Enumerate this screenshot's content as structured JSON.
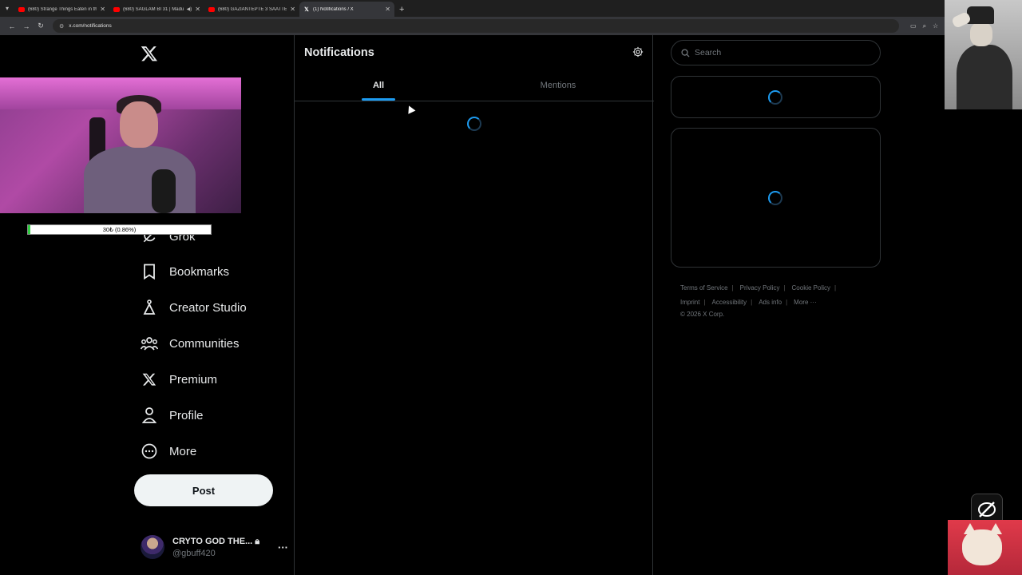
{
  "browser": {
    "tabs": [
      {
        "title": "(680) Strange Things Eaten in th",
        "favicon": "youtube-icon"
      },
      {
        "title": "(680) SAĞLAM Bİ 31 | Madu",
        "favicon": "youtube-icon"
      },
      {
        "title": "(680) GAZİANTEPTE 3 SAATTE",
        "favicon": "youtube-icon"
      },
      {
        "title": "(1) Notifications / X",
        "favicon": "x-icon",
        "active": true
      }
    ],
    "url": "x.com/notifications"
  },
  "sidebar": {
    "items": [
      {
        "label": "Grok",
        "icon": "grok-icon"
      },
      {
        "label": "Bookmarks",
        "icon": "bookmark-icon"
      },
      {
        "label": "Creator Studio",
        "icon": "creator-studio-icon"
      },
      {
        "label": "Communities",
        "icon": "communities-icon"
      },
      {
        "label": "Premium",
        "icon": "x-icon"
      },
      {
        "label": "Profile",
        "icon": "person-icon"
      },
      {
        "label": "More",
        "icon": "more-circle-icon"
      }
    ],
    "post_label": "Post",
    "account": {
      "name": "CRYTO GOD THE...",
      "handle": "@gbuff420"
    }
  },
  "stream_overlay": {
    "progress_text": "30₺ (0.86%)",
    "progress_fraction": 0.0086
  },
  "main": {
    "title": "Notifications",
    "tabs": [
      {
        "label": "All",
        "active": true
      },
      {
        "label": "Mentions",
        "active": false
      }
    ]
  },
  "right": {
    "search_placeholder": "Search",
    "footer_row1": [
      "Terms of Service",
      "Privacy Policy",
      "Cookie Policy"
    ],
    "footer_row2": [
      "Imprint",
      "Accessibility",
      "Ads info",
      "More ···"
    ],
    "copyright": "© 2026 X Corp."
  },
  "colors": {
    "accent": "#1d9bf0",
    "background": "#000000",
    "border": "#2f3336",
    "muted": "#71767b"
  }
}
